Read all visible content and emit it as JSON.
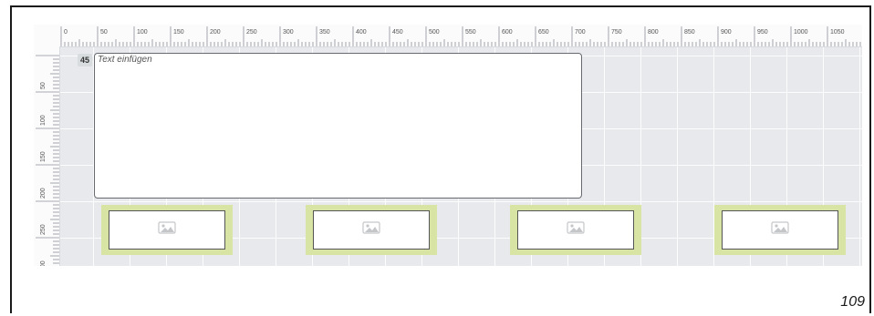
{
  "ruler": {
    "top_labels": [
      "0",
      "50",
      "100",
      "150",
      "200",
      "250",
      "300",
      "350",
      "400",
      "450",
      "500",
      "550",
      "600",
      "650",
      "700",
      "750",
      "800",
      "850",
      "900",
      "950",
      "1000",
      "1050"
    ],
    "left_labels": [
      "50",
      "100",
      "150",
      "200",
      "250",
      "300"
    ]
  },
  "editor": {
    "line_number": "45",
    "text_placeholder": "Text einfügen"
  },
  "image_slots": [
    {
      "icon": "image-icon"
    },
    {
      "icon": "image-icon"
    },
    {
      "icon": "image-icon"
    },
    {
      "icon": "image-icon"
    }
  ],
  "page": {
    "number": "109"
  },
  "colors": {
    "canvas": "#e7e9ec",
    "image_slot_highlight": "#d7e4a3",
    "frame": "#1a1a1a"
  }
}
